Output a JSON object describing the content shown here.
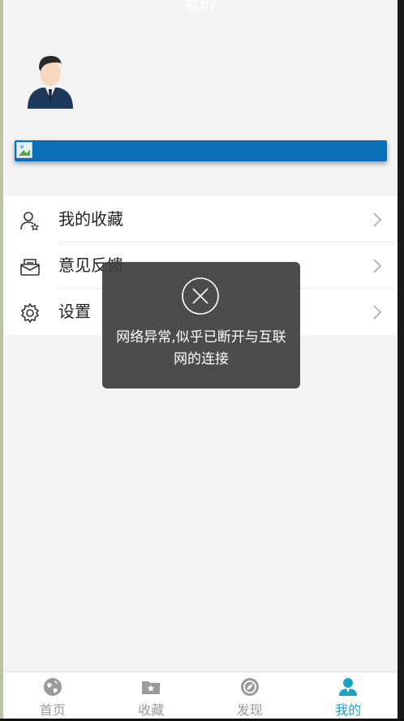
{
  "header": {
    "title": "我的"
  },
  "profile": {
    "avatar_icon": "user-avatar-icon"
  },
  "banner": {
    "color": "#0a6fb6",
    "image_icon": "broken-image-icon"
  },
  "menu": {
    "items": [
      {
        "label": "我的收藏",
        "icon": "user-star-icon"
      },
      {
        "label": "意见反馈",
        "icon": "mail-tray-icon"
      },
      {
        "label": "设置",
        "icon": "gear-icon"
      }
    ]
  },
  "toast": {
    "icon": "close-circle-icon",
    "message": "网络异常,似乎已断开与互联网的连接"
  },
  "tabbar": {
    "active_color": "#19a3c4",
    "tabs": [
      {
        "label": "首页",
        "icon": "globe-icon",
        "active": false
      },
      {
        "label": "收藏",
        "icon": "folder-star-icon",
        "active": false
      },
      {
        "label": "发现",
        "icon": "compass-icon",
        "active": false
      },
      {
        "label": "我的",
        "icon": "person-icon",
        "active": true
      }
    ]
  }
}
